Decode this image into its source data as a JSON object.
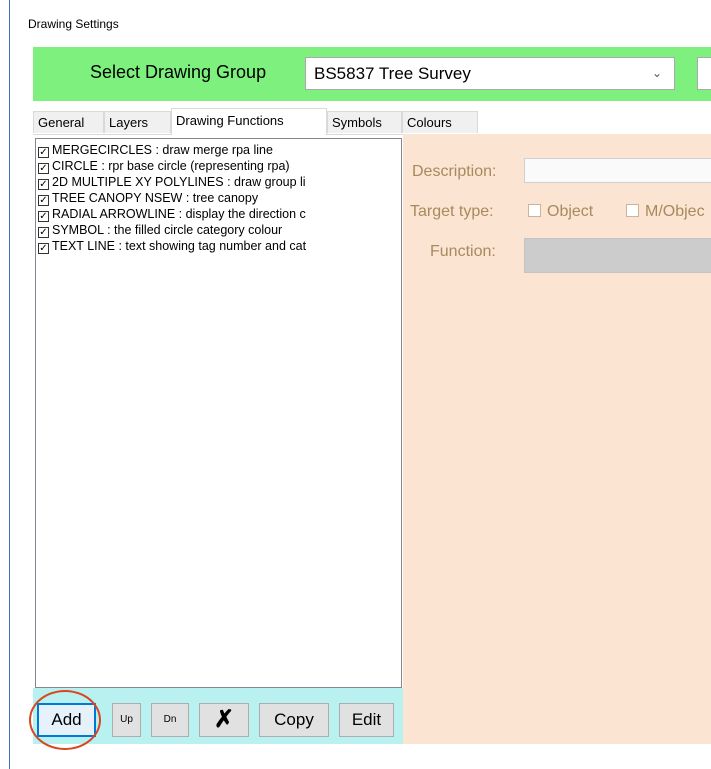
{
  "window": {
    "title": "Drawing Settings"
  },
  "group": {
    "label": "Select Drawing Group",
    "selected": "BS5837 Tree Survey"
  },
  "tabs": [
    "General",
    "Layers",
    "Drawing Functions",
    "Symbols",
    "Colours"
  ],
  "functions": [
    {
      "checked": true,
      "text": "MERGECIRCLES : draw merge rpa line"
    },
    {
      "checked": true,
      "text": "CIRCLE : rpr base circle (representing rpa)"
    },
    {
      "checked": true,
      "text": "2D MULTIPLE XY POLYLINES : draw group li"
    },
    {
      "checked": true,
      "text": "TREE CANOPY NSEW : tree canopy"
    },
    {
      "checked": true,
      "text": "RADIAL ARROWLINE : display the direction c"
    },
    {
      "checked": true,
      "text": "SYMBOL : the filled circle category colour"
    },
    {
      "checked": true,
      "text": "TEXT LINE : text showing tag number and cat"
    }
  ],
  "buttons": {
    "add": "Add",
    "up": "Up",
    "dn": "Dn",
    "delete": "✗",
    "copy": "Copy",
    "edit": "Edit"
  },
  "details": {
    "description_label": "Description:",
    "target_label": "Target type:",
    "object_option": "Object",
    "mobject_option": "M/Objec",
    "function_label": "Function:"
  },
  "colors": {
    "group_bar": "#7df07d",
    "button_bar": "#b9f0f0",
    "detail_panel": "#fbe4d1",
    "highlight_circle": "#d9461f"
  }
}
